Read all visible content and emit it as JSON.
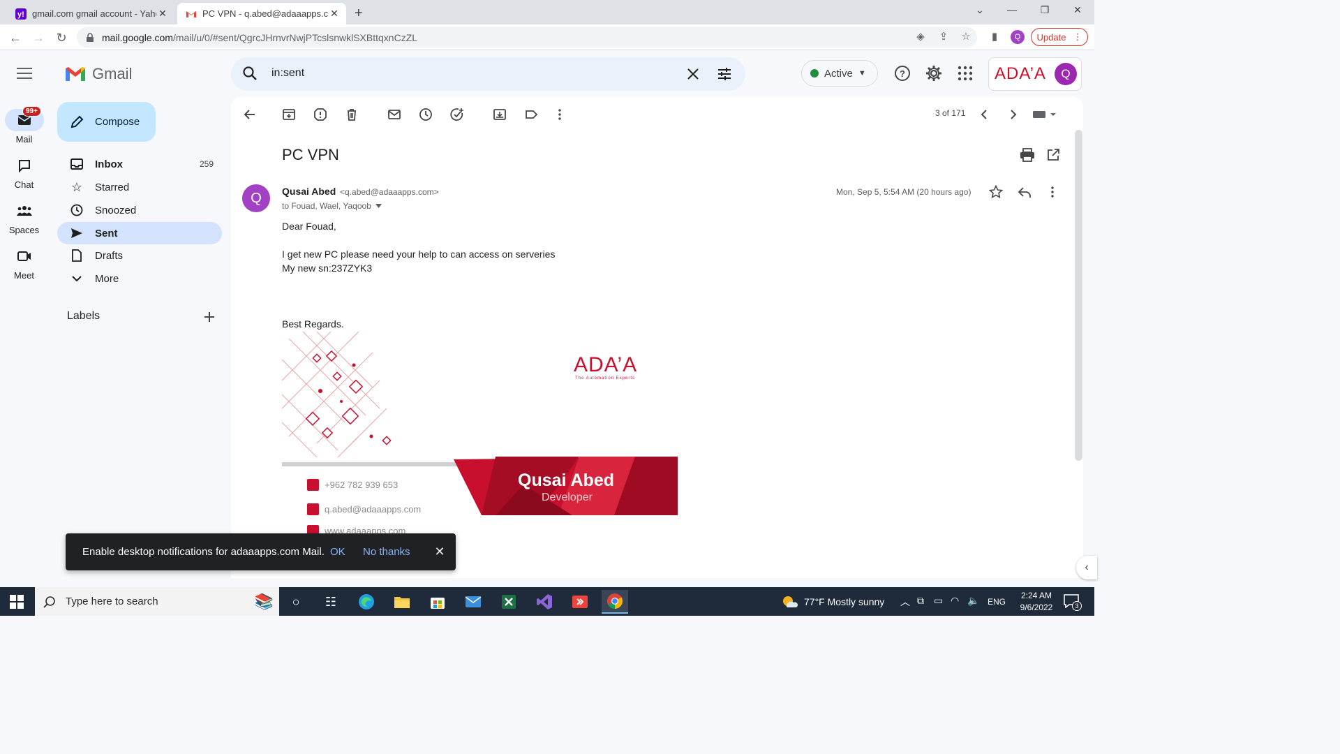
{
  "browser": {
    "tabs": [
      {
        "title": "gmail.com gmail account - Yahoo",
        "favicon": "yahoo-favicon"
      },
      {
        "title": "PC VPN - q.abed@adaaapps.com",
        "favicon": "gmail-favicon",
        "active": true
      }
    ],
    "url_host": "mail.google.com",
    "url_path": "/mail/u/0/#sent/QgrcJHrnvrNwjPTcslsnwklSXBttqxnCzZL",
    "profile_initial": "Q",
    "update_label": "Update"
  },
  "gmail": {
    "app_name": "Gmail",
    "search_query": "in:sent",
    "status_label": "Active",
    "org_logo": "ADA’A",
    "account_initial": "Q"
  },
  "rail": {
    "items": [
      {
        "label": "Mail",
        "icon": "mail-icon",
        "badge": "99+"
      },
      {
        "label": "Chat",
        "icon": "chat-icon"
      },
      {
        "label": "Spaces",
        "icon": "spaces-icon"
      },
      {
        "label": "Meet",
        "icon": "meet-icon"
      }
    ]
  },
  "sidebar": {
    "compose_label": "Compose",
    "items": [
      {
        "label": "Inbox",
        "count": "259"
      },
      {
        "label": "Starred",
        "count": ""
      },
      {
        "label": "Snoozed",
        "count": ""
      },
      {
        "label": "Sent",
        "count": ""
      },
      {
        "label": "Drafts",
        "count": ""
      },
      {
        "label": "More",
        "count": ""
      }
    ],
    "labels_title": "Labels"
  },
  "toolbar": {
    "pager": "3 of 171"
  },
  "message": {
    "subject": "PC VPN",
    "sender_initial": "Q",
    "sender_name": "Qusai Abed",
    "sender_email": "<q.abed@adaaapps.com>",
    "recipients": "to Fouad, Wael, Yaqoob",
    "date": "Mon, Sep 5, 5:54 AM (20 hours ago)",
    "body": {
      "greeting": "Dear Fouad,",
      "line1": "I get new PC please need your help  to can access on serveries",
      "line2": "My new sn:237ZYK3",
      "closing": "Best Regards."
    },
    "signature": {
      "name": "Qusai Abed",
      "role": "Developer",
      "phone": "+962 782 939 653",
      "email": "q.abed@adaaapps.com",
      "website": "www.adaaapps.com",
      "logo": "ADA’A",
      "tagline": "The Automation Experts"
    }
  },
  "snackbar": {
    "text": "Enable desktop notifications for adaaapps.com Mail.",
    "ok": "OK",
    "no_thanks": "No thanks"
  },
  "taskbar": {
    "search_placeholder": "Type here to search",
    "weather": "77°F  Mostly sunny",
    "language": "ENG",
    "time": "2:24 AM",
    "date": "9/6/2022",
    "notification_count": "3"
  },
  "colors": {
    "accent": "#0b57d0",
    "compose_bg": "#c2e7ff",
    "selected_nav": "#d3e3fd",
    "brand_red": "#c8102e",
    "avatar_purple": "#a142c4"
  }
}
